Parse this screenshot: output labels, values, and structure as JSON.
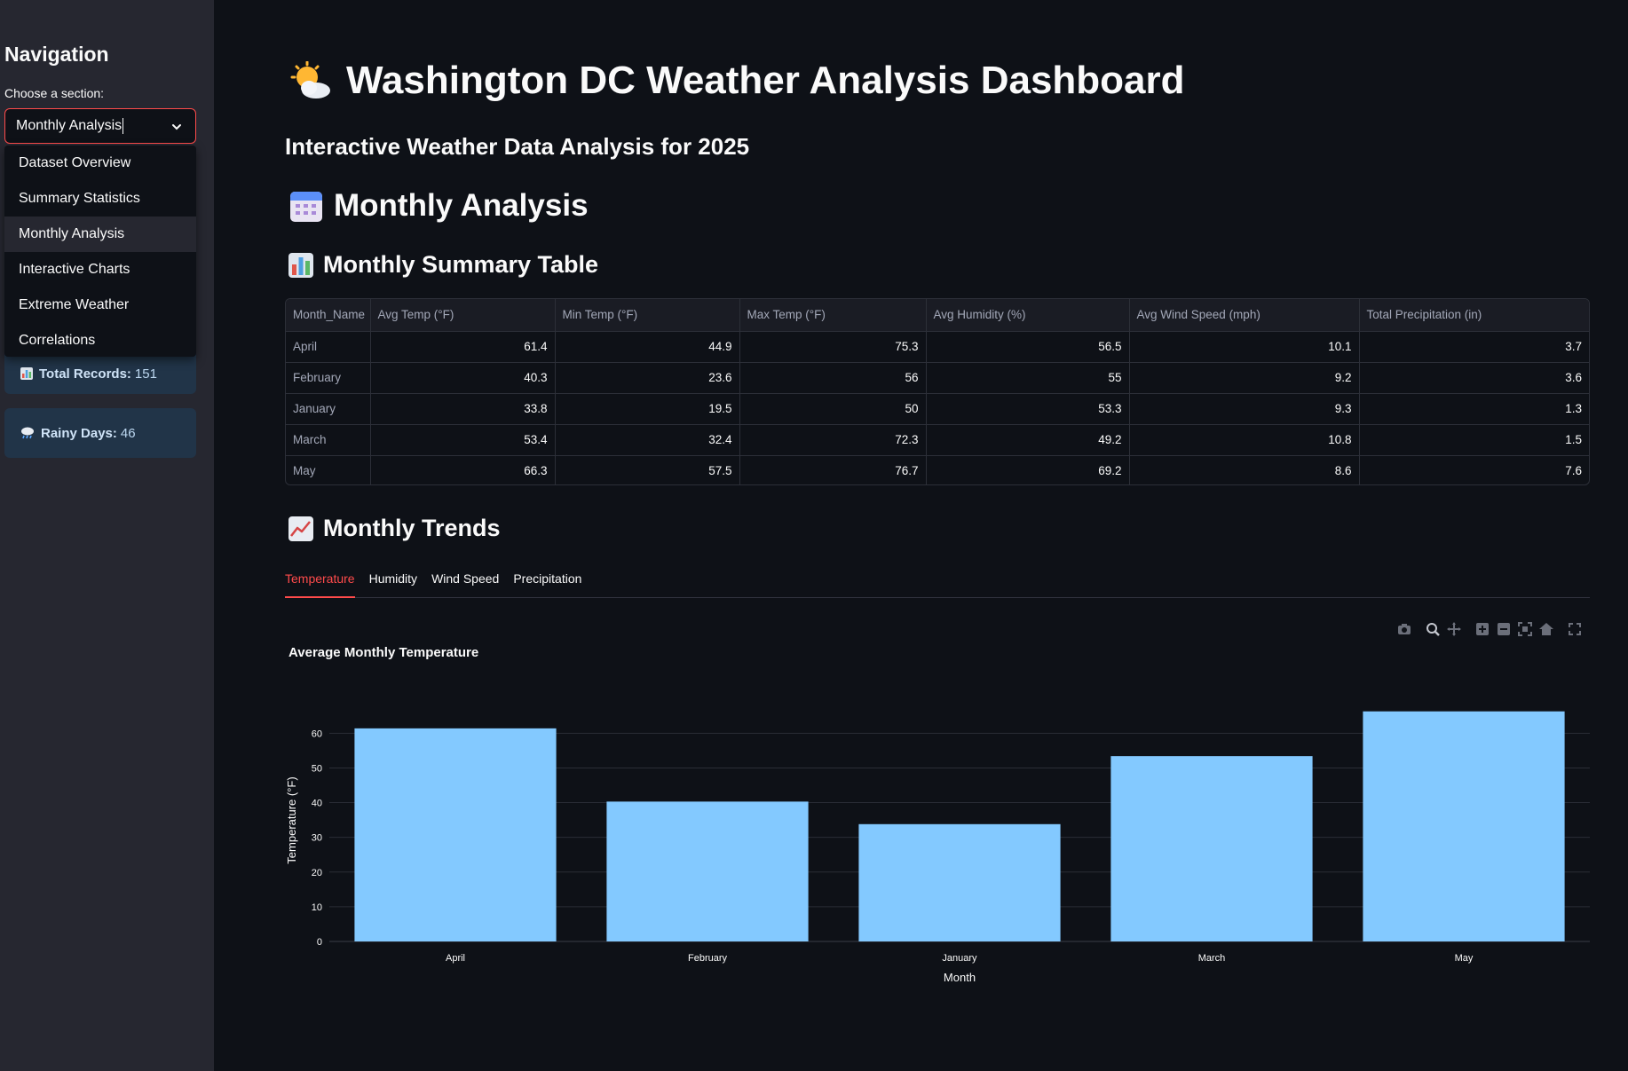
{
  "sidebar": {
    "title": "Navigation",
    "select_label": "Choose a section:",
    "selected": "Monthly Analysis",
    "options": [
      "Dataset Overview",
      "Summary Statistics",
      "Monthly Analysis",
      "Interactive Charts",
      "Extreme Weather",
      "Correlations"
    ],
    "total_records_label": "Total Records:",
    "total_records_value": "151",
    "rainy_days_label": "Rainy Days:",
    "rainy_days_value": "46"
  },
  "header": {
    "title": "Washington DC Weather Analysis Dashboard",
    "subtitle": "Interactive Weather Data Analysis for 2025"
  },
  "section": {
    "title": "Monthly Analysis",
    "table_heading": "Monthly Summary Table",
    "trends_heading": "Monthly Trends"
  },
  "table": {
    "columns": [
      "Month_Name",
      "Avg Temp (°F)",
      "Min Temp (°F)",
      "Max Temp (°F)",
      "Avg Humidity (%)",
      "Avg Wind Speed (mph)",
      "Total Precipitation (in)"
    ],
    "rows": [
      [
        "April",
        "61.4",
        "44.9",
        "75.3",
        "56.5",
        "10.1",
        "3.7"
      ],
      [
        "February",
        "40.3",
        "23.6",
        "56",
        "55",
        "9.2",
        "3.6"
      ],
      [
        "January",
        "33.8",
        "19.5",
        "50",
        "53.3",
        "9.3",
        "1.3"
      ],
      [
        "March",
        "53.4",
        "32.4",
        "72.3",
        "49.2",
        "10.8",
        "1.5"
      ],
      [
        "May",
        "66.3",
        "57.5",
        "76.7",
        "69.2",
        "8.6",
        "7.6"
      ]
    ]
  },
  "tabs": [
    "Temperature",
    "Humidity",
    "Wind Speed",
    "Precipitation"
  ],
  "active_tab": "Temperature",
  "colors": {
    "accent": "#ff4b4b",
    "bar": "#83c9ff",
    "card_bg": "#213448"
  },
  "chart_data": {
    "type": "bar",
    "title": "Average Monthly Temperature",
    "xlabel": "Month",
    "ylabel": "Temperature (°F)",
    "categories": [
      "April",
      "February",
      "January",
      "March",
      "May"
    ],
    "values": [
      61.4,
      40.3,
      33.8,
      53.4,
      66.3
    ],
    "ylim": [
      0,
      69.8
    ],
    "yticks": [
      0,
      10,
      20,
      30,
      40,
      50,
      60
    ],
    "grid": true
  }
}
